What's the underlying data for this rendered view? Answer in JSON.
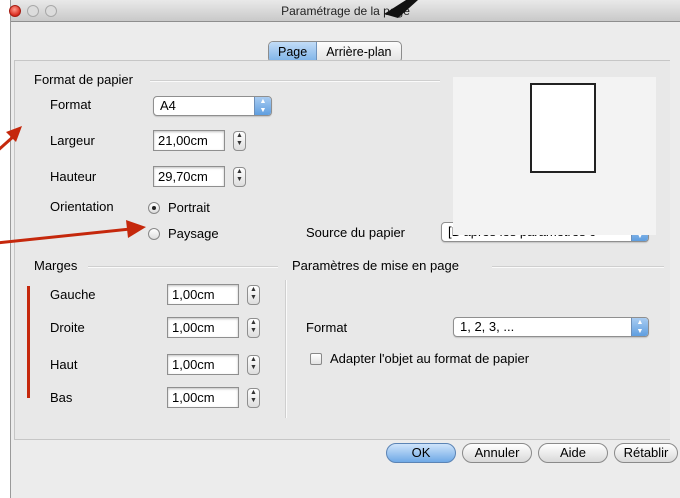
{
  "window": {
    "title": "Paramétrage de la page"
  },
  "tabs": [
    "Page",
    "Arrière-plan"
  ],
  "paper_format": {
    "heading": "Format de papier",
    "format_label": "Format",
    "format_value": "A4",
    "width_label": "Largeur",
    "width_value": "21,00cm",
    "height_label": "Hauteur",
    "height_value": "29,70cm",
    "orientation_label": "Orientation",
    "portrait_label": "Portrait",
    "landscape_label": "Paysage",
    "orientation_selected": "Portrait",
    "source_label": "Source du papier",
    "source_value": "[D'après les paramètres c"
  },
  "margins": {
    "heading": "Marges",
    "left_label": "Gauche",
    "left_value": "1,00cm",
    "right_label": "Droite",
    "right_value": "1,00cm",
    "top_label": "Haut",
    "top_value": "1,00cm",
    "bottom_label": "Bas",
    "bottom_value": "1,00cm"
  },
  "layout_settings": {
    "heading": "Paramètres de mise en page",
    "format_label": "Format",
    "format_value": "1, 2, 3, ...",
    "fit_object_label": "Adapter l'objet au format de papier",
    "fit_object_checked": false
  },
  "buttons": {
    "ok": "OK",
    "cancel": "Annuler",
    "help": "Aide",
    "reset": "Rétablir"
  },
  "colors": {
    "annotation": "#c5280c",
    "accent": "#6fa9e6"
  }
}
